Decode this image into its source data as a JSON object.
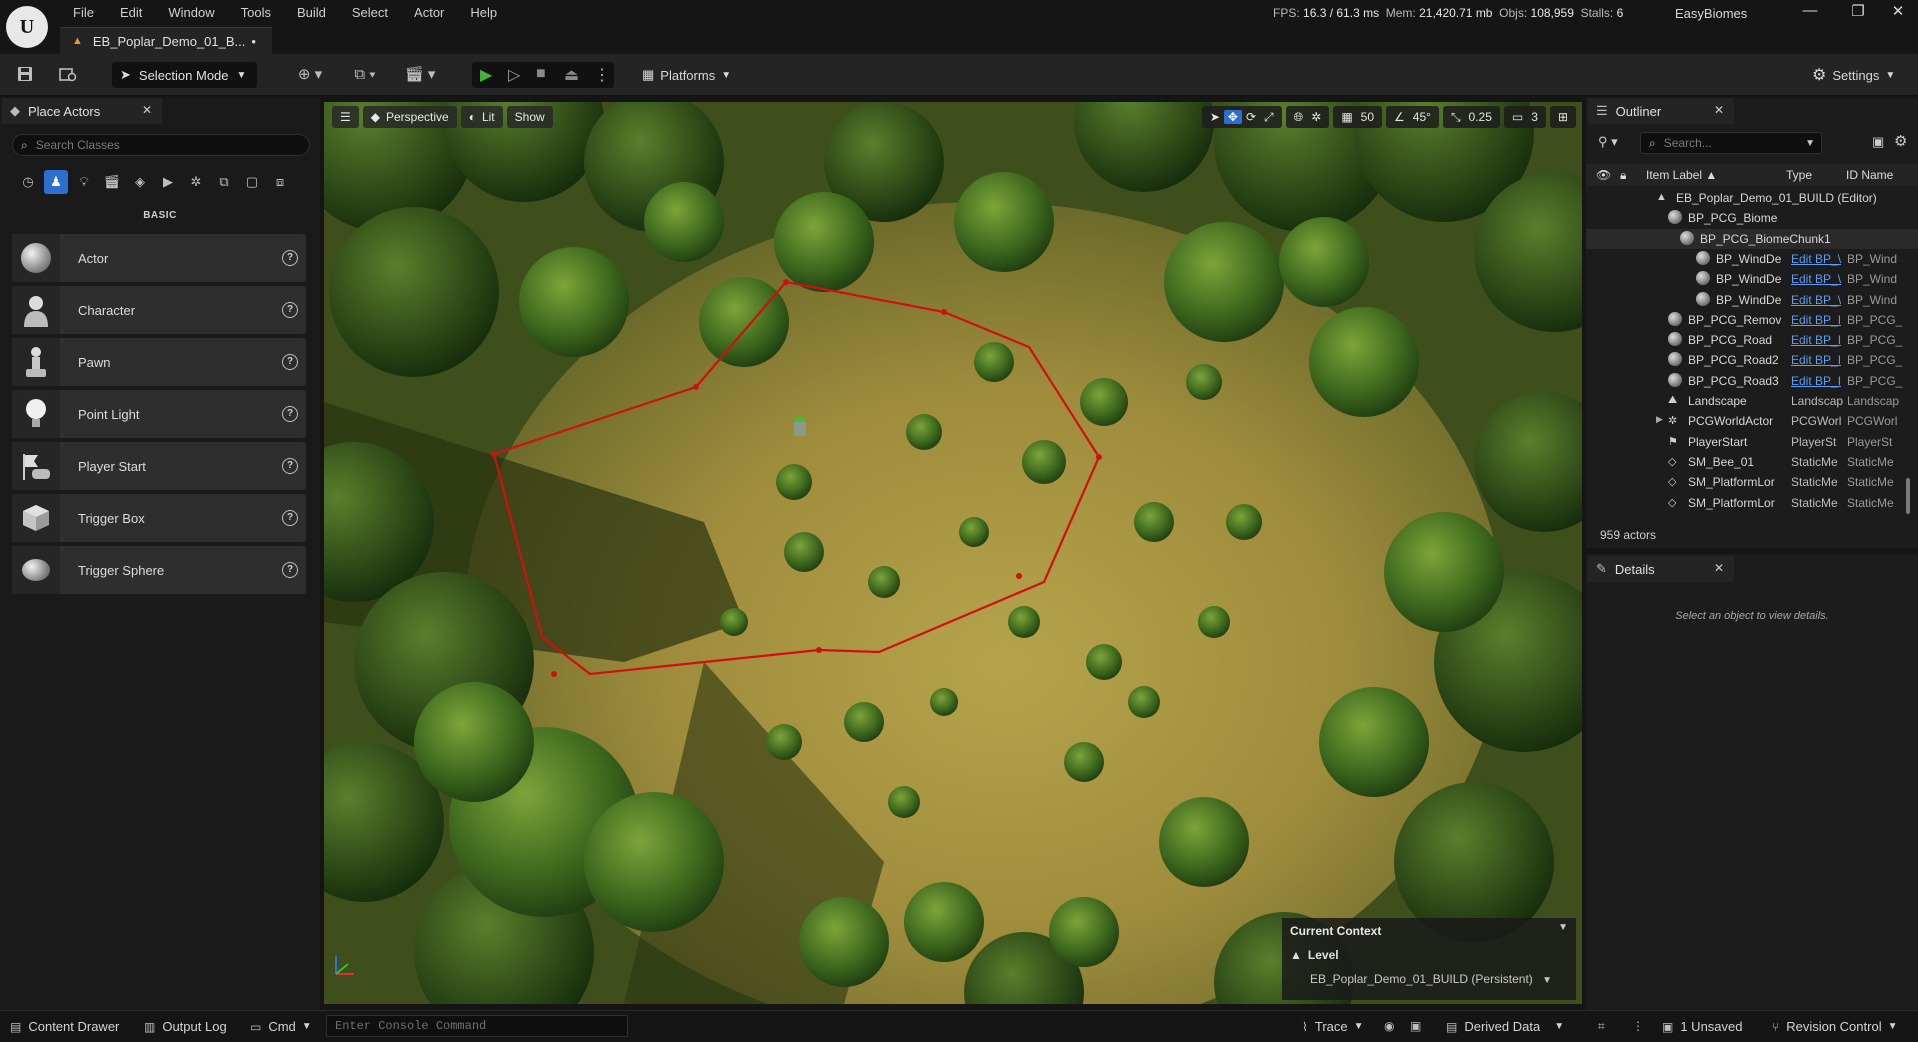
{
  "menu": [
    "File",
    "Edit",
    "Window",
    "Tools",
    "Build",
    "Select",
    "Actor",
    "Help"
  ],
  "document_tab": "EB_Poplar_Demo_01_B...",
  "document_dirty": "•",
  "stats": {
    "fps_label": "FPS:",
    "fps": "16.3",
    "ms": "/ 61.3 ms",
    "mem_label": "Mem:",
    "mem": "21,420.71 mb",
    "objs_label": "Objs:",
    "objs": "108,959",
    "stalls_label": "Stalls:",
    "stalls": "6"
  },
  "project_name": "EasyBiomes",
  "toolbar": {
    "selection_mode": "Selection Mode",
    "platforms": "Platforms",
    "settings": "Settings"
  },
  "place_actors": {
    "tab_title": "Place Actors",
    "search_placeholder": "Search Classes",
    "category": "BASIC",
    "items": [
      "Actor",
      "Character",
      "Pawn",
      "Point Light",
      "Player Start",
      "Trigger Box",
      "Trigger Sphere"
    ]
  },
  "viewport": {
    "perspective": "Perspective",
    "lit": "Lit",
    "show": "Show",
    "grid_snap": "50",
    "rotate_snap": "45°",
    "scale_snap": "0.25",
    "camera_speed": "3",
    "context": {
      "title": "Current Context",
      "level_label": "Level",
      "level_value": "EB_Poplar_Demo_01_BUILD (Persistent)"
    },
    "spline_color": "#d01010"
  },
  "outliner": {
    "tab_title": "Outliner",
    "search_placeholder": "Search...",
    "columns": {
      "label": "Item Label ▲",
      "type": "Type",
      "id": "ID Name"
    },
    "rows": [
      {
        "name": "EB_Poplar_Demo_01_BUILD (Editor)",
        "type": "",
        "id": ""
      },
      {
        "name": "BP_PCG_Biome",
        "type": "",
        "id": ""
      },
      {
        "name": "BP_PCG_BiomeChunk1",
        "type": "",
        "id": ""
      },
      {
        "name": "BP_WindDe",
        "type": "Edit BP_\\",
        "id": "BP_Wind"
      },
      {
        "name": "BP_WindDe",
        "type": "Edit BP_\\",
        "id": "BP_Wind"
      },
      {
        "name": "BP_WindDe",
        "type": "Edit BP_\\",
        "id": "BP_Wind"
      },
      {
        "name": "BP_PCG_Remov",
        "type": "Edit BP_I",
        "id": "BP_PCG_"
      },
      {
        "name": "BP_PCG_Road",
        "type": "Edit BP_I",
        "id": "BP_PCG_"
      },
      {
        "name": "BP_PCG_Road2",
        "type": "Edit BP_I",
        "id": "BP_PCG_"
      },
      {
        "name": "BP_PCG_Road3",
        "type": "Edit BP_I",
        "id": "BP_PCG_"
      },
      {
        "name": "Landscape",
        "type": "Landscap",
        "id": "Landscap"
      },
      {
        "name": "PCGWorldActor",
        "type": "PCGWorl",
        "id": "PCGWorl"
      },
      {
        "name": "PlayerStart",
        "type": "PlayerSt",
        "id": "PlayerSt"
      },
      {
        "name": "SM_Bee_01",
        "type": "StaticMe",
        "id": "StaticMe"
      },
      {
        "name": "SM_PlatformLor",
        "type": "StaticMe",
        "id": "StaticMe"
      },
      {
        "name": "SM_PlatformLor",
        "type": "StaticMe",
        "id": "StaticMe"
      }
    ],
    "actor_count": "959 actors"
  },
  "details": {
    "tab_title": "Details",
    "hint": "Select an object to view details."
  },
  "statusbar": {
    "content_drawer": "Content Drawer",
    "output_log": "Output Log",
    "cmd": "Cmd",
    "console_placeholder": "Enter Console Command",
    "trace": "Trace",
    "derived_data": "Derived Data",
    "unsaved": "1 Unsaved",
    "revision_control": "Revision Control"
  }
}
